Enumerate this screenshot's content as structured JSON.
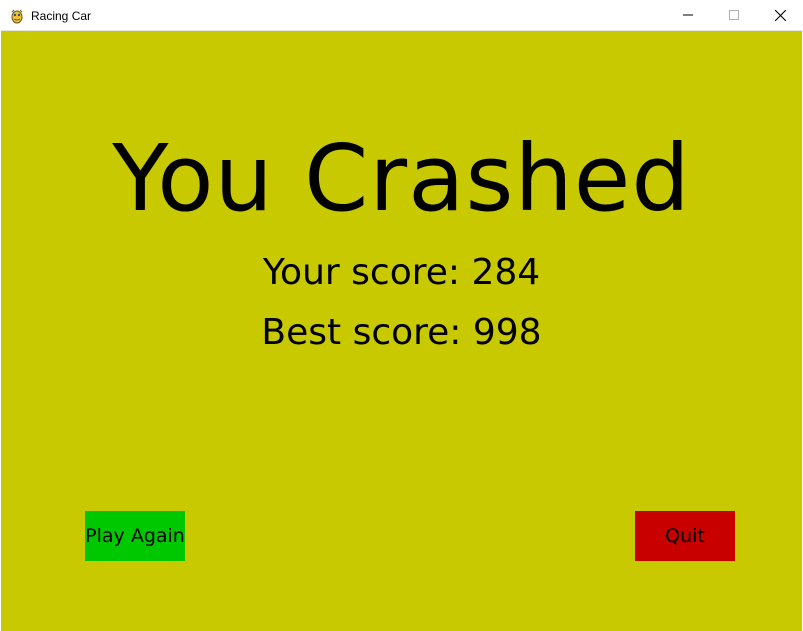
{
  "window": {
    "title": "Racing Car",
    "app_icon": "pygame-snake-icon",
    "controls": {
      "minimize_icon": "minimize-icon",
      "maximize_icon": "maximize-icon",
      "close_icon": "close-icon"
    }
  },
  "game": {
    "background_color": "#c9c900",
    "headline": "You Crashed",
    "current_score_text": "Your score: 284",
    "best_score_text": "Best score: 998",
    "buttons": {
      "play_again_label": "Play Again",
      "play_again_color": "#00c800",
      "quit_label": "Quit",
      "quit_color": "#c80000"
    }
  }
}
